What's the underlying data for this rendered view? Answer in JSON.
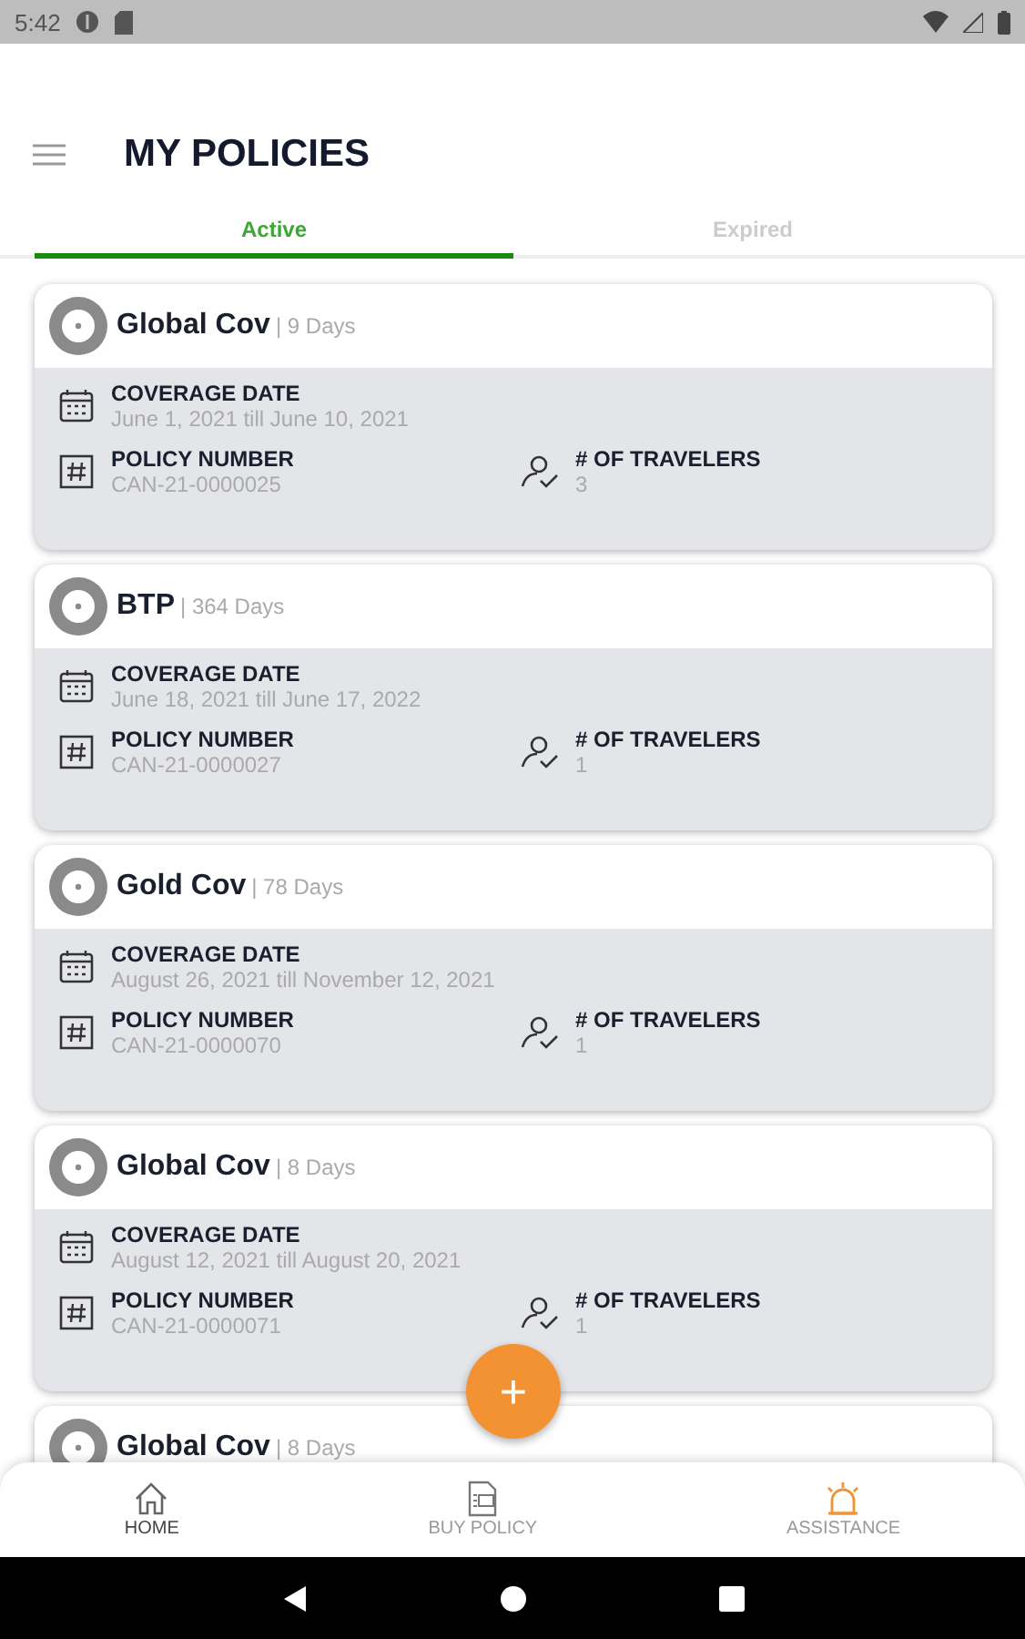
{
  "status_bar": {
    "time": "5:42"
  },
  "header": {
    "title": "MY POLICIES"
  },
  "tabs": [
    {
      "label": "Active",
      "selected": true
    },
    {
      "label": "Expired",
      "selected": false
    }
  ],
  "policies": [
    {
      "name": "Global Cov",
      "duration": "| 9 Days",
      "coverage_label": "COVERAGE DATE",
      "coverage": "June 1, 2021 till June 10, 2021",
      "number_label": "POLICY NUMBER",
      "number": "CAN-21-0000025",
      "travelers_label": "# OF TRAVELERS",
      "travelers": "3"
    },
    {
      "name": "BTP",
      "duration": "| 364 Days",
      "coverage_label": "COVERAGE DATE",
      "coverage": "June 18, 2021 till June 17, 2022",
      "number_label": "POLICY NUMBER",
      "number": "CAN-21-0000027",
      "travelers_label": "# OF TRAVELERS",
      "travelers": "1"
    },
    {
      "name": "Gold Cov",
      "duration": "| 78 Days",
      "coverage_label": "COVERAGE DATE",
      "coverage": "August 26, 2021 till November 12, 2021",
      "number_label": "POLICY NUMBER",
      "number": "CAN-21-0000070",
      "travelers_label": "# OF TRAVELERS",
      "travelers": "1"
    },
    {
      "name": "Global Cov",
      "duration": "| 8 Days",
      "coverage_label": "COVERAGE DATE",
      "coverage": "August 12, 2021 till August 20, 2021",
      "number_label": "POLICY NUMBER",
      "number": "CAN-21-0000071",
      "travelers_label": "# OF TRAVELERS",
      "travelers": "1"
    },
    {
      "name": "Global Cov",
      "duration": "| 8 Days"
    }
  ],
  "fab": {
    "label": "+"
  },
  "bottom_nav": [
    {
      "kind": "home",
      "label": "HOME",
      "selected": true
    },
    {
      "kind": "policy",
      "label": "BUY POLICY",
      "selected": false
    },
    {
      "kind": "alarm",
      "label": "ASSISTANCE",
      "selected": false
    }
  ]
}
